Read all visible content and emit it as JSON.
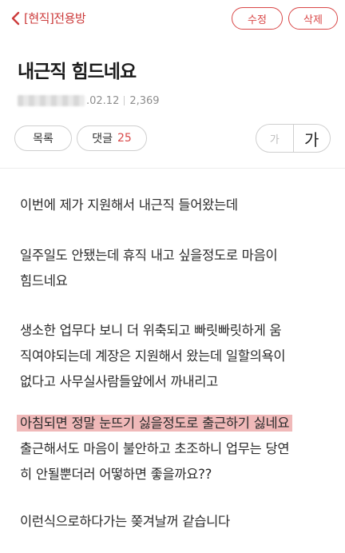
{
  "header": {
    "board_name": "[현직]전용방",
    "edit_label": "수정",
    "delete_label": "삭제",
    "accent_color": "#d94848"
  },
  "post": {
    "title": "내근직 힘드네요",
    "date": ".02.12",
    "views": "2,369"
  },
  "actions": {
    "list_label": "목록",
    "comment_label": "댓글",
    "comment_count": "25",
    "font_small": "가",
    "font_large": "가"
  },
  "body": {
    "p1_line1": "이번에 제가 지원해서 내근직 들어왔는데",
    "p2_line1": "일주일도 안됐는데 휴직 내고 싶을정도로 마음이",
    "p2_line2": "힘드네요",
    "p3_line1": "생소한 업무다 보니 더 위축되고 빠릿빠릿하게 움",
    "p3_line2": "직여야되는데 계장은 지원해서 왔는데 일할의욕이",
    "p3_line3": "없다고 사무실사람들앞에서 까내리고",
    "p4_highlight": "아침되면 정말 눈뜨기 싫을정도로 출근하기 싫네요",
    "p4_line2": "출근해서도 마음이 불안하고 초조하니 업무는 당연",
    "p4_line3": "히 안될뿐더러 어떻하면 좋을까요??",
    "p5_line1": "이런식으로하다가는 쫒겨날꺼 같습니다",
    "highlight_color": "#f0b9b9"
  }
}
